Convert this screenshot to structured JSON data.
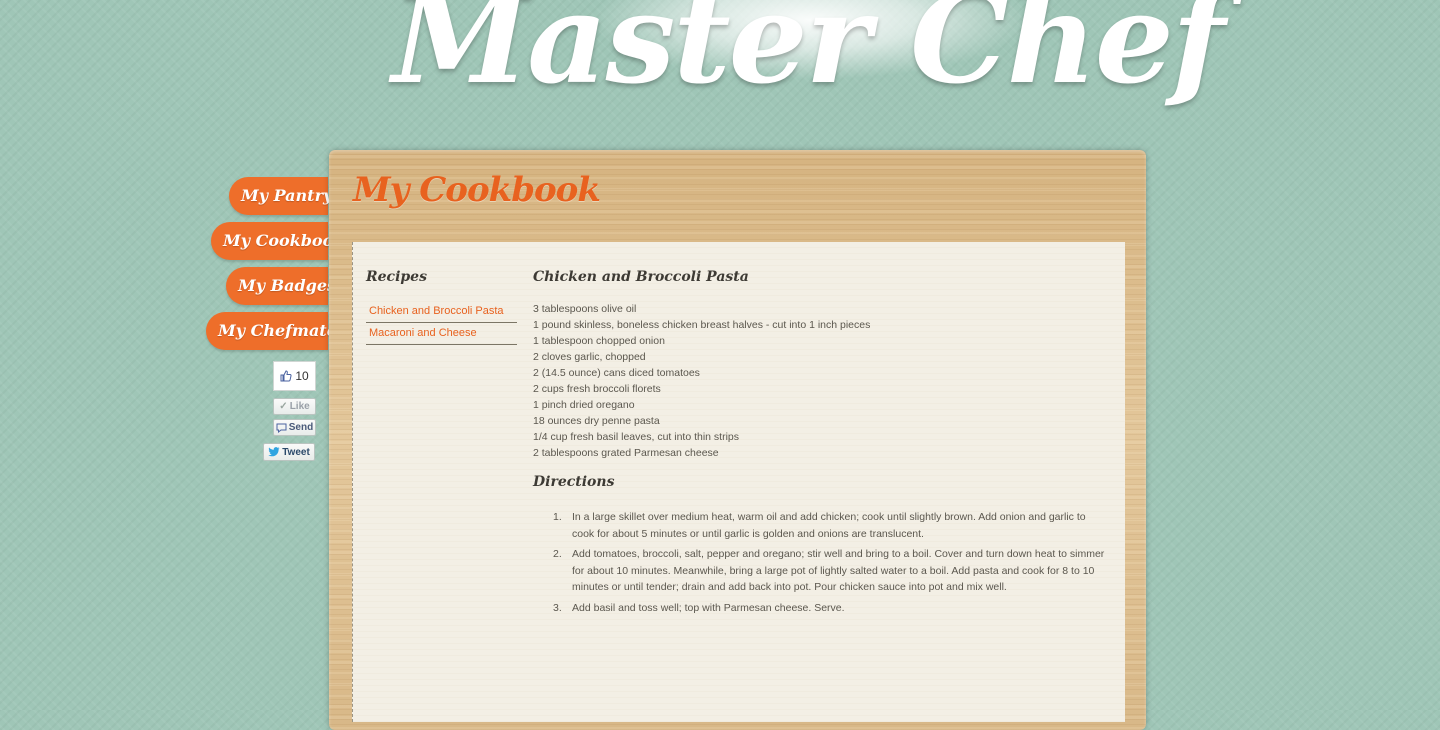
{
  "logo": {
    "text": "Master Chef"
  },
  "nav": {
    "items": [
      {
        "label": "My Pantry"
      },
      {
        "label": "My Cookbook"
      },
      {
        "label": "My Badges"
      },
      {
        "label": "My Chefmates"
      }
    ]
  },
  "social": {
    "like_count": "10",
    "like_label": "Like",
    "send_label": "Send",
    "tweet_label": "Tweet"
  },
  "page": {
    "title": "My Cookbook"
  },
  "recipes": {
    "heading": "Recipes",
    "items": [
      {
        "label": "Chicken and Broccoli Pasta"
      },
      {
        "label": "Macaroni and Cheese"
      }
    ]
  },
  "recipe": {
    "title": "Chicken and Broccoli Pasta",
    "ingredients": [
      "3 tablespoons olive oil",
      "1 pound skinless, boneless chicken breast halves - cut into 1 inch pieces",
      "1 tablespoon chopped onion",
      "2 cloves garlic, chopped",
      "2 (14.5 ounce) cans diced tomatoes",
      "2 cups fresh broccoli florets",
      "1 pinch dried oregano",
      "18 ounces dry penne pasta",
      "1/4 cup fresh basil leaves, cut into thin strips",
      "2 tablespoons grated Parmesan cheese"
    ],
    "directions_heading": "Directions",
    "directions": [
      {
        "num": "1.",
        "text": "In a large skillet over medium heat, warm oil and add chicken; cook until slightly brown. Add onion and garlic to cook for about 5 minutes or until garlic is golden and onions are translucent."
      },
      {
        "num": "2.",
        "text": "Add tomatoes, broccoli, salt, pepper and oregano; stir well and bring to a boil. Cover and turn down heat to simmer for about 10 minutes. Meanwhile, bring a large pot of lightly salted water to a boil. Add pasta and cook for 8 to 10 minutes or until tender; drain and add back into pot. Pour chicken sauce into pot and mix well."
      },
      {
        "num": "3.",
        "text": "Add basil and toss well; top with Parmesan cheese. Serve."
      }
    ]
  },
  "colors": {
    "background": "#9fc6b7",
    "accent": "#ee6e2a",
    "title": "#e8621f",
    "paper": "#f3efe5"
  }
}
